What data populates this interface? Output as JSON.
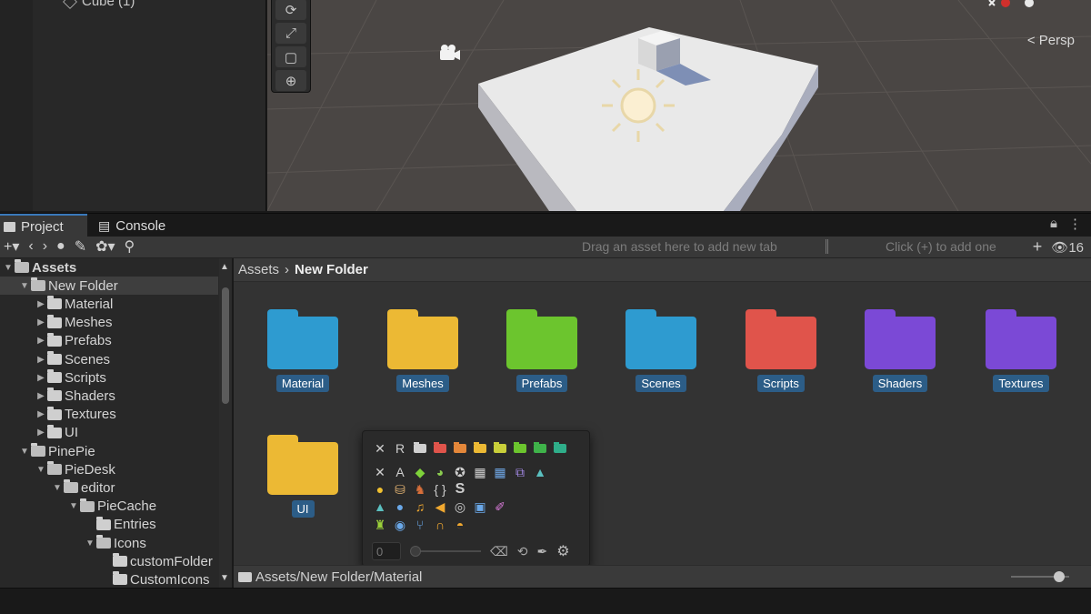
{
  "hierarchy": {
    "item_label": "Cube (1)"
  },
  "scene": {
    "view_label": "< Persp",
    "tools": [
      "rotate-tool",
      "scale-tool",
      "rect-tool",
      "transform-tool"
    ]
  },
  "tabs": [
    {
      "label": "Project",
      "active": true
    },
    {
      "label": "Console",
      "active": false
    }
  ],
  "toolbar": {
    "drag_hint": "Drag an asset here to add new tab",
    "click_hint": "Click (+) to add one",
    "visible_count": "16"
  },
  "tree": {
    "items": [
      {
        "label": "Assets",
        "depth": 0,
        "open": true
      },
      {
        "label": "New Folder",
        "depth": 1,
        "open": true,
        "selected": true
      },
      {
        "label": "Material",
        "depth": 2,
        "open": false
      },
      {
        "label": "Meshes",
        "depth": 2,
        "open": false
      },
      {
        "label": "Prefabs",
        "depth": 2,
        "open": false
      },
      {
        "label": "Scenes",
        "depth": 2,
        "open": false
      },
      {
        "label": "Scripts",
        "depth": 2,
        "open": false
      },
      {
        "label": "Shaders",
        "depth": 2,
        "open": false
      },
      {
        "label": "Textures",
        "depth": 2,
        "open": false
      },
      {
        "label": "UI",
        "depth": 2,
        "open": false
      },
      {
        "label": "PinePie",
        "depth": 1,
        "open": true
      },
      {
        "label": "PieDesk",
        "depth": 2,
        "open": true
      },
      {
        "label": "editor",
        "depth": 3,
        "open": true
      },
      {
        "label": "PieCache",
        "depth": 4,
        "open": true
      },
      {
        "label": "Entries",
        "depth": 5,
        "leaf": true
      },
      {
        "label": "Icons",
        "depth": 5,
        "open": true
      },
      {
        "label": "customFolder",
        "depth": 6,
        "leaf": true
      },
      {
        "label": "CustomIcons",
        "depth": 6,
        "leaf": true
      }
    ]
  },
  "breadcrumb": {
    "root": "Assets",
    "current": "New Folder"
  },
  "folders": [
    {
      "label": "Material",
      "color": "#2e9bd0"
    },
    {
      "label": "Meshes",
      "color": "#ecb934"
    },
    {
      "label": "Prefabs",
      "color": "#6cc52e"
    },
    {
      "label": "Scenes",
      "color": "#2e9bd0"
    },
    {
      "label": "Scripts",
      "color": "#e0544b"
    },
    {
      "label": "Shaders",
      "color": "#7b49d6"
    },
    {
      "label": "Textures",
      "color": "#7b49d6"
    },
    {
      "label": "UI",
      "color": "#ecb934"
    }
  ],
  "icon_picker": {
    "row1_color_folders": [
      "#d0d0d0",
      "#e0544b",
      "#e4873a",
      "#ecb934",
      "#c9cf3a",
      "#6cc52e",
      "#3fb34a",
      "#2fae8a"
    ],
    "row1_letter": "R",
    "row2_letter": "A",
    "row3_symbols": [
      "{ }",
      "S"
    ],
    "size_value": "0"
  },
  "status_path": "Assets/New Folder/Material"
}
